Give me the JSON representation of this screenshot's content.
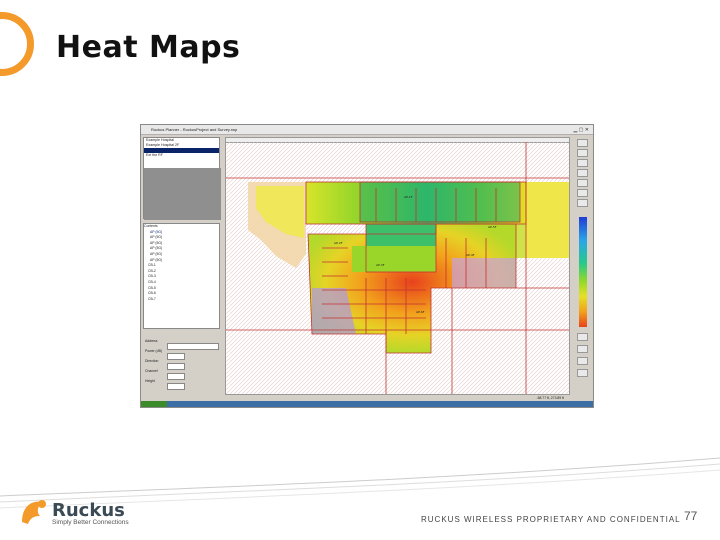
{
  "slide": {
    "title": "Heat Maps",
    "footer_text": "RUCKUS WIRELESS PROPRIETARY AND CONFIDENTIAL",
    "page_number": "77",
    "accent_color": "#f39a2b"
  },
  "brand": {
    "name": "Ruckus",
    "tagline": "Simply Better Connections",
    "logo_color": "#f39a2b"
  },
  "embedded_app": {
    "title": "Ruckus Planner - RuckusProject and Survey.rwp",
    "list_items": [
      "Example Hospital",
      "Example Hospital 2F",
      "",
      "Ext the RF"
    ],
    "tree_items": [
      "Contents",
      "AP (5G)",
      "AP (5G)",
      "AP (5G)",
      "AP (5G)",
      "AP (5G)",
      "AP (5G)",
      "CB-1",
      "CB-2",
      "CB-3",
      "CB-4",
      "CB-5",
      "CB-6",
      "CB-7"
    ],
    "props_labels": [
      "Address",
      "Power (dB)",
      "Direction",
      "Channel",
      "Height"
    ],
    "status_text": "-58.77 ft, 273.89 ft",
    "legend_colors": [
      "#1f3dd6",
      "#2aa7e6",
      "#27c98a",
      "#8fd92a",
      "#e6e026",
      "#f2a21c",
      "#e8421c"
    ]
  }
}
